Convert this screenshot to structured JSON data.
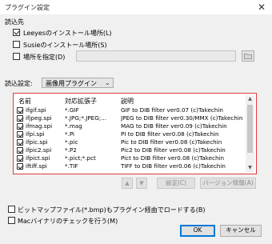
{
  "window": {
    "title": "プラグイン設定",
    "close_glyph": "✕"
  },
  "load_source": {
    "section_label": "読込先",
    "options": [
      {
        "label": "Leeyesのインストール場所(L)",
        "checked": true
      },
      {
        "label": "Susieのインストール場所(S)",
        "checked": false
      },
      {
        "label": "場所を指定(D)",
        "checked": false
      }
    ],
    "path_value": ""
  },
  "load_settings": {
    "label": "読込設定:",
    "selected": "画像用プラグイン"
  },
  "plugin_list": {
    "columns": [
      "名前",
      "対応拡張子",
      "説明"
    ],
    "rows": [
      {
        "name": "ifgif.spi",
        "ext": "*.GIF",
        "desc": "GIF to DIB filter ver0.07 (c)Takechin",
        "checked": true
      },
      {
        "name": "ifjpeg.spi",
        "ext": "*.JPG;*.JPEG;...",
        "desc": "JPEG to DIB filter ver0.30/MMX (c)Takechin",
        "checked": true
      },
      {
        "name": "ifmag.spi",
        "ext": "*.mag",
        "desc": "MAG to DIB filter ver0.09 (c)Takechin",
        "checked": true
      },
      {
        "name": "ifpi.spi",
        "ext": "*.Pi",
        "desc": "PI to DIB filter ver0.08 (c)Takechin",
        "checked": true
      },
      {
        "name": "ifpic.spi",
        "ext": "*.pic",
        "desc": "Pic to DIB filter ver0.08 (c)Takechin",
        "checked": true
      },
      {
        "name": "ifpic2.spi",
        "ext": "*.P2",
        "desc": "Pic2 to DIB filter ver0.08 (c)Takechin",
        "checked": true
      },
      {
        "name": "ifpict.spi",
        "ext": "*.pict;*.pct",
        "desc": "Pict to DIB filter ver0.08 (c)Takechin",
        "checked": true
      },
      {
        "name": "iftiff.spi",
        "ext": "*.TIF",
        "desc": "TIFF to DIB filter ver0.06 (c)Takechin",
        "checked": true
      }
    ]
  },
  "list_buttons": {
    "up_glyph": "▲",
    "down_glyph": "▼",
    "settings": "設定(C)",
    "version": "バージョン情報(A)"
  },
  "options": {
    "bitmap_via_plugin": "ビットマップファイル(*.bmp)もプラグイン経由でロードする(B)",
    "mac_binary_check": "Macバイナリのチェックを行う(M)"
  },
  "dialog_buttons": {
    "ok": "OK",
    "cancel": "キャンセル"
  },
  "colors": {
    "highlight_border": "#e0393c",
    "primary_border": "#0078d7"
  }
}
